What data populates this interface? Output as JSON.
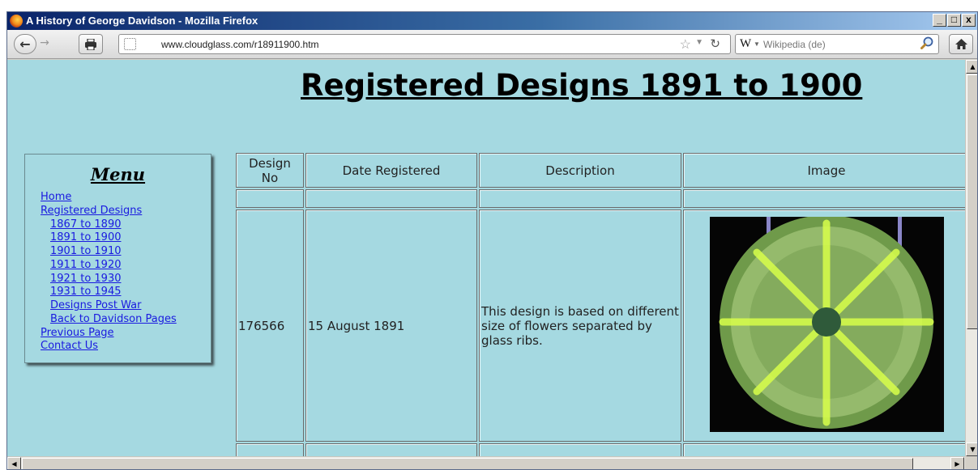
{
  "window": {
    "title": "A History of George Davidson - Mozilla Firefox",
    "controls": {
      "minimize": "_",
      "maximize": "□",
      "close": "x"
    }
  },
  "navbar": {
    "url": "www.cloudglass.com/r18911900.htm",
    "search_engine": "W",
    "search_placeholder": "Wikipedia (de)",
    "icons": [
      "back-arrow-icon",
      "forward-arrow-icon",
      "print-icon",
      "site-identity-icon",
      "bookmark-star-icon",
      "reload-icon",
      "search-magnifier-icon",
      "home-icon"
    ]
  },
  "page": {
    "heading": "Registered Designs 1891 to 1900",
    "background_color": "#a5d9e1"
  },
  "menu": {
    "title": "Menu",
    "items": [
      {
        "label": "Home",
        "sub": false
      },
      {
        "label": "Registered Designs",
        "sub": false
      },
      {
        "label": "1867 to 1890",
        "sub": true
      },
      {
        "label": "1891 to 1900",
        "sub": true
      },
      {
        "label": "1901 to 1910",
        "sub": true
      },
      {
        "label": "1911 to 1920",
        "sub": true
      },
      {
        "label": "1921 to 1930",
        "sub": true
      },
      {
        "label": "1931 to 1945",
        "sub": true
      },
      {
        "label": "Designs Post War",
        "sub": true
      },
      {
        "label": "Back to Davidson Pages",
        "sub": true
      },
      {
        "label": "Previous Page",
        "sub": false
      },
      {
        "label": "Contact Us",
        "sub": false
      }
    ]
  },
  "table": {
    "headers": [
      "Design No",
      "Date Registered",
      "Description",
      "Image"
    ],
    "rows": [
      {
        "design_no": "176566",
        "date": "15 August 1891",
        "description": "This design is based on different size of flowers separated by glass ribs.",
        "image_subject": "green-uranium-glass-plate-icon"
      }
    ]
  }
}
